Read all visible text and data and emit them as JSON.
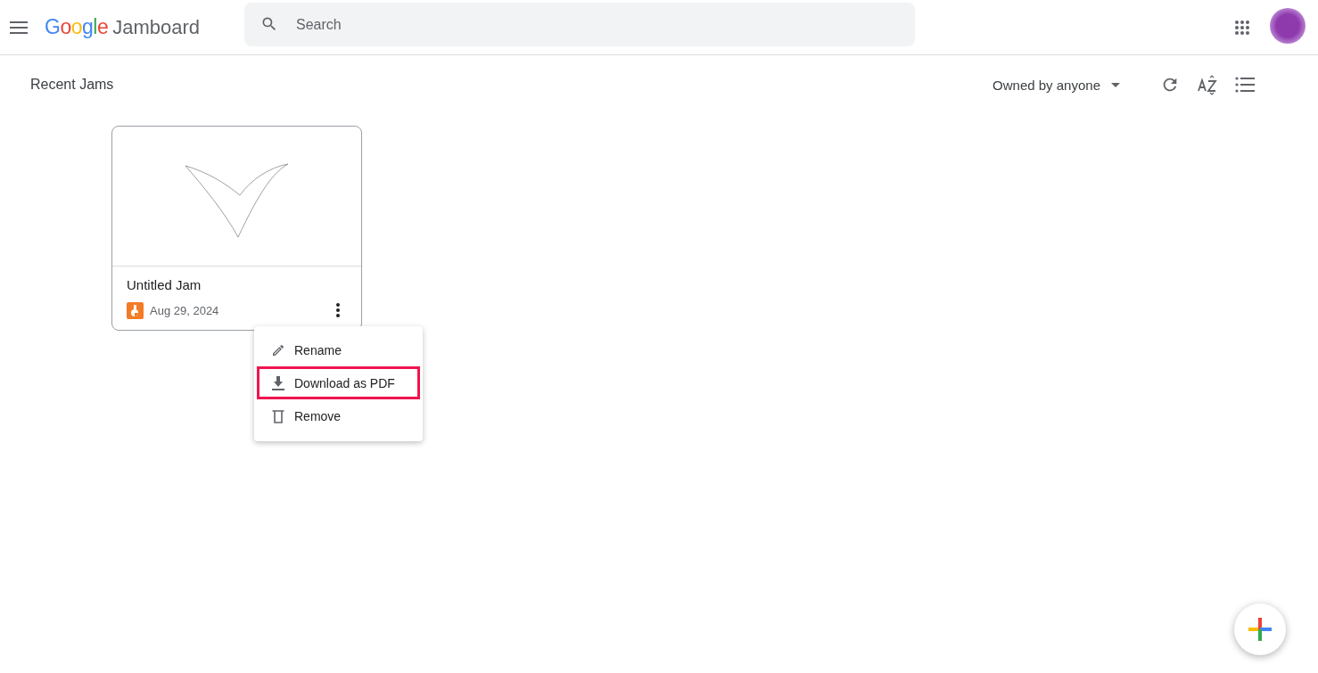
{
  "header": {
    "logo_brand": "Google",
    "logo_product": "Jamboard",
    "search": {
      "placeholder": "Search"
    }
  },
  "toolbar": {
    "title": "Recent Jams",
    "owner_filter": "Owned by anyone"
  },
  "jams": [
    {
      "title": "Untitled Jam",
      "date": "Aug 29, 2024"
    }
  ],
  "menu": [
    {
      "kind": "rename",
      "label": "Rename",
      "highlighted": false
    },
    {
      "kind": "download",
      "label": "Download as PDF",
      "highlighted": true
    },
    {
      "kind": "remove",
      "label": "Remove",
      "highlighted": false
    }
  ]
}
